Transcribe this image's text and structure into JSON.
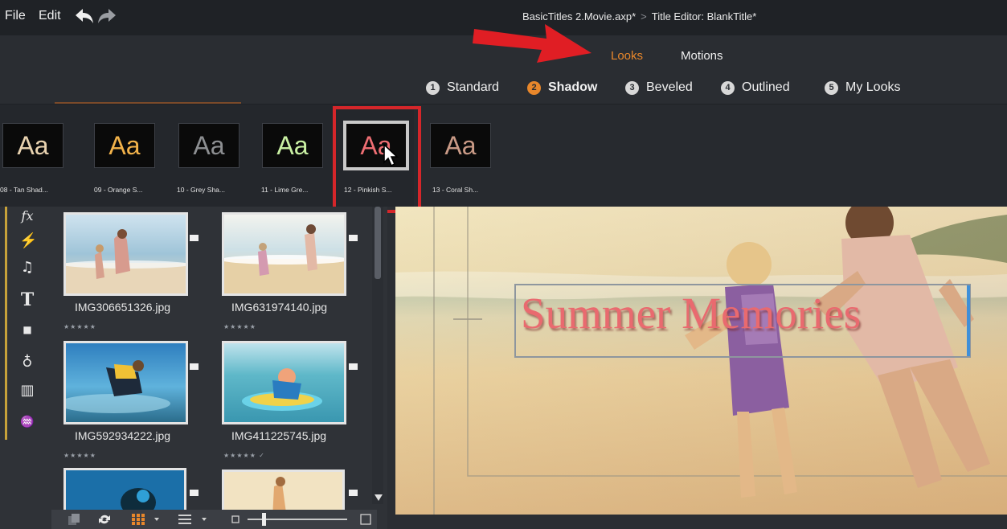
{
  "menu": {
    "file_label": "File",
    "edit_label": "Edit"
  },
  "document": {
    "project": "BasicTitles 2.Movie.axp*",
    "separator": ">",
    "editor": "Title Editor: BlankTitle*"
  },
  "tabs": [
    {
      "label": "Looks",
      "active": true
    },
    {
      "label": "Motions",
      "active": false
    }
  ],
  "subtabs": [
    {
      "num": "1",
      "label": "Standard",
      "active": false
    },
    {
      "num": "2",
      "label": "Shadow",
      "active": true
    },
    {
      "num": "3",
      "label": "Beveled",
      "active": false
    },
    {
      "num": "4",
      "label": "Outlined",
      "active": false
    },
    {
      "num": "5",
      "label": "My Looks",
      "active": false
    }
  ],
  "looks": [
    {
      "glyph": "Aa",
      "caption": "08 - Tan Shad...",
      "color": "#e9d3b0"
    },
    {
      "glyph": "Aa",
      "caption": "09 - Orange S...",
      "color": "#f2b24a"
    },
    {
      "glyph": "Aa",
      "caption": "10 - Grey Sha...",
      "color": "#8d8f92"
    },
    {
      "glyph": "Aa",
      "caption": "11 - Lime Gre...",
      "color": "#c9f0a3"
    },
    {
      "glyph": "Aa",
      "caption": "12 - Pinkish S...",
      "color": "#ee6e73",
      "selected": true
    },
    {
      "glyph": "Aa",
      "caption": "13 - Coral Sh...",
      "color": "#c99a86"
    }
  ],
  "tools": [
    {
      "icon": "fx-icon",
      "glyph": "fx"
    },
    {
      "icon": "lightning-icon",
      "glyph": "⚡"
    },
    {
      "icon": "music-icon",
      "glyph": "♫"
    },
    {
      "icon": "text-icon",
      "glyph": "T"
    },
    {
      "icon": "overlay-icon",
      "glyph": "■"
    },
    {
      "icon": "fill-icon",
      "glyph": "♁"
    },
    {
      "icon": "film-icon",
      "glyph": "▥"
    },
    {
      "icon": "audio-icon",
      "glyph": "♒"
    }
  ],
  "library": {
    "items": [
      {
        "name": "IMG306651326.jpg",
        "stars": "★★★★★",
        "checked": false
      },
      {
        "name": "IMG631974140.jpg",
        "stars": "★★★★★",
        "checked": false
      },
      {
        "name": "IMG592934222.jpg",
        "stars": "★★★★★",
        "checked": false
      },
      {
        "name": "IMG411225745.jpg",
        "stars": "★★★★★ ✓",
        "checked": true
      }
    ]
  },
  "preview": {
    "title_text": "Summer Memories"
  },
  "colors": {
    "accent": "#e8872b",
    "highlight": "#d5262a",
    "title": "#e96a6f"
  }
}
